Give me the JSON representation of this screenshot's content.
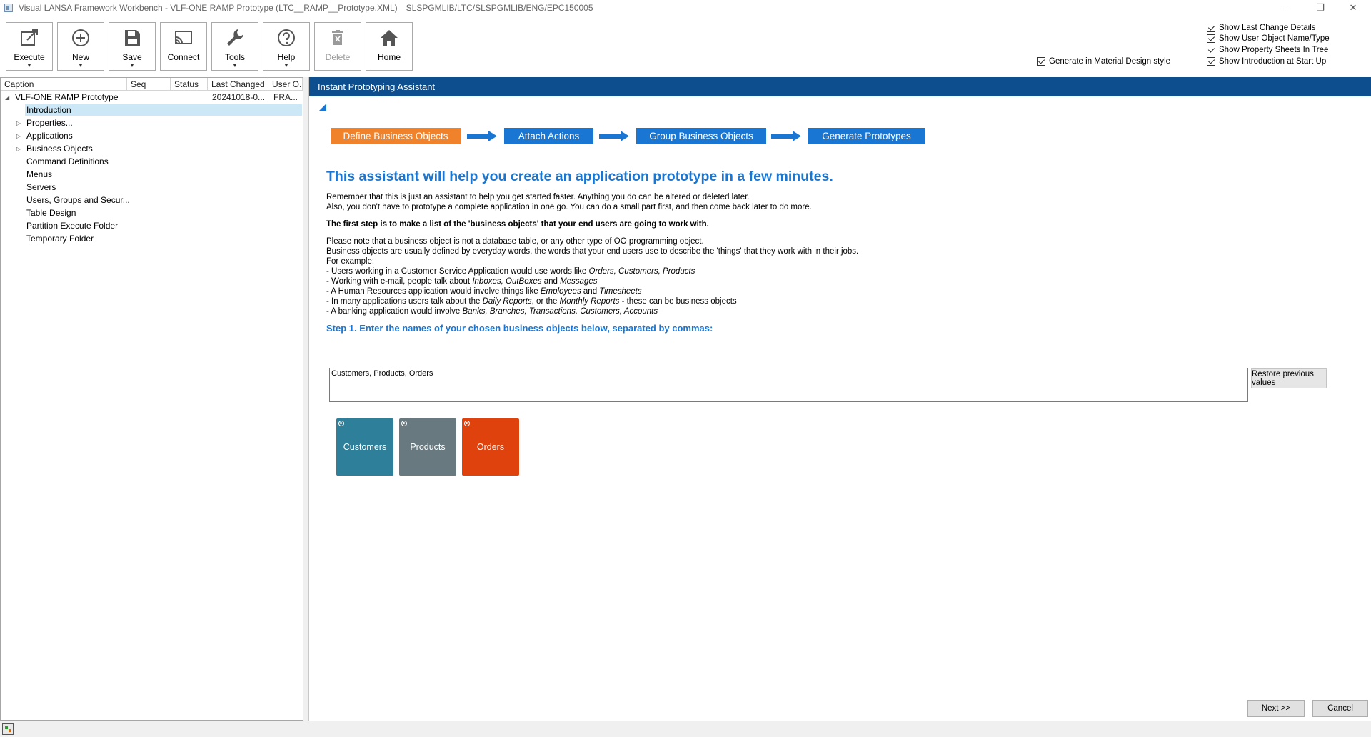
{
  "window": {
    "title": "Visual LANSA Framework Workbench - VLF-ONE RAMP Prototype (LTC__RAMP__Prototype.XML)",
    "path": "SLSPGMLIB/LTC/SLSPGMLIB/ENG/EPC150005",
    "minimize_glyph": "—",
    "restore_glyph": "❐",
    "close_glyph": "✕"
  },
  "toolbar": {
    "execute": "Execute",
    "new": "New",
    "save": "Save",
    "connect": "Connect",
    "tools": "Tools",
    "help": "Help",
    "delete": "Delete",
    "home": "Home",
    "dropdown_glyph": "▼"
  },
  "options": {
    "show_last_change": "Show Last Change Details",
    "show_user_object": "Show User Object Name/Type",
    "show_property_sheets": "Show Property Sheets In Tree",
    "show_introduction": "Show Introduction at Start Up",
    "material_design": "Generate in Material Design style"
  },
  "tree": {
    "columns": [
      "Caption",
      "Seq",
      "Status",
      "Last Changed",
      "User O..."
    ],
    "root": {
      "label": "VLF-ONE RAMP Prototype",
      "last_changed": "20241018-0...",
      "user": "FRA..."
    },
    "items": [
      {
        "label": "Introduction",
        "expandable": false
      },
      {
        "label": "Properties...",
        "expandable": true
      },
      {
        "label": "Applications",
        "expandable": true
      },
      {
        "label": "Business Objects",
        "expandable": true
      },
      {
        "label": "Command Definitions",
        "expandable": false
      },
      {
        "label": "Menus",
        "expandable": false
      },
      {
        "label": "Servers",
        "expandable": false
      },
      {
        "label": "Users, Groups and Secur...",
        "expandable": false
      },
      {
        "label": "Table Design",
        "expandable": false
      },
      {
        "label": "Partition Execute Folder",
        "expandable": false
      },
      {
        "label": "Temporary Folder",
        "expandable": false
      }
    ]
  },
  "assistant": {
    "header": "Instant Prototyping Assistant",
    "steps": [
      "Define Business Objects",
      "Attach Actions",
      "Group Business Objects",
      "Generate Prototypes"
    ],
    "headline": "This assistant will help you create an application prototype in a few minutes.",
    "p1_line1": "Remember that this is just an assistant to help you get started faster. Anything you do can be altered or deleted later.",
    "p1_line2": "Also, you don't have to prototype a complete application in one go. You can do a small part first, and then come back later to do more.",
    "first_step": "The first step is to make a list of the 'business objects' that your end users are going to work with.",
    "note_line1": "Please note that a business object is not a database table, or any other type of OO programming object.",
    "note_line2": "Business objects are usually defined by everyday words, the words that your end users use to describe the 'things' that they work with in their jobs.",
    "note_line3": "For example:",
    "ex1_a": "- Users working in a Customer Service Application would use words like ",
    "ex1_b": "Orders, Customers, Products",
    "ex2_a": "- Working with e-mail, people talk about ",
    "ex2_b": "Inboxes, OutBoxes",
    "ex2_c": " and ",
    "ex2_d": "Messages",
    "ex3_a": "- A Human Resources application would involve things like ",
    "ex3_b": "Employees",
    "ex3_c": " and ",
    "ex3_d": "Timesheets",
    "ex4_a": "- In many applications users talk about the ",
    "ex4_b": "Daily Reports",
    "ex4_c": ", or the ",
    "ex4_d": "Monthly Reports",
    "ex4_e": " - these can be business objects",
    "ex5_a": "- A banking application would involve ",
    "ex5_b": "Banks, Branches, Transactions, Customers, Accounts",
    "step1": "Step 1. Enter the names of your chosen business objects below, separated by commas:",
    "input_value": "Customers, Products, Orders",
    "restore_button": "Restore previous values",
    "tiles": [
      {
        "label": "Customers",
        "color": "#2e7f9a"
      },
      {
        "label": "Products",
        "color": "#687a7f"
      },
      {
        "label": "Orders",
        "color": "#e0420e"
      }
    ],
    "next_button": "Next >>",
    "cancel_button": "Cancel"
  },
  "colors": {
    "header_blue": "#0d4f8e",
    "step_blue": "#1976d2",
    "step_orange": "#f0822c",
    "selection": "#cce8f6"
  }
}
